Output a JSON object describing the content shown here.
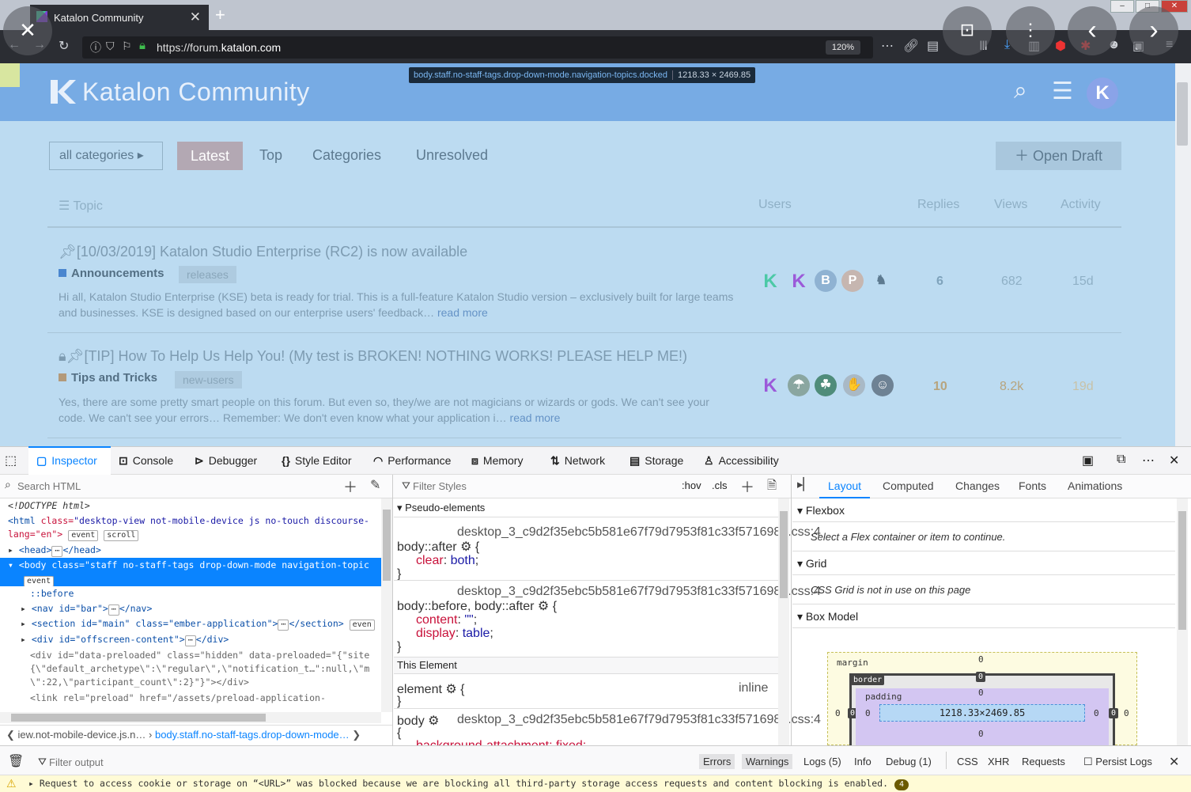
{
  "browser": {
    "tab_title": "Katalon Community",
    "new_tab": "+",
    "url_host_prefix": "https://forum.",
    "url_host": "katalon.com",
    "zoom": "120%"
  },
  "overlay": {
    "close": "✕",
    "prev": "‹",
    "next": "›"
  },
  "page": {
    "logo_text": "Katalon Community",
    "selector_tag": "body.staff.no-staff-tags.drop-down-mode.navigation-topics.docked",
    "selector_size": "1218.33 × 2469.85",
    "nav": {
      "all_categories": "all categories",
      "latest": "Latest",
      "top": "Top",
      "categories": "Categories",
      "unresolved": "Unresolved",
      "open_draft": "Open Draft"
    },
    "columns": {
      "topic": "Topic",
      "users": "Users",
      "replies": "Replies",
      "views": "Views",
      "activity": "Activity"
    },
    "topics": [
      {
        "title": "[10/03/2019] Katalon Studio Enterprise (RC2) is now available",
        "category": "Announcements",
        "category_color": "#4a86cf",
        "tag": "releases",
        "excerpt": "Hi all, Katalon Studio Enterprise (KSE) beta is ready for trial. This is a full-feature Katalon Studio version – exclusively built for large teams and businesses. KSE is designed based on our enterprise users' feedback…",
        "read_more": "read more",
        "replies": "6",
        "views": "682",
        "activity": "15d"
      },
      {
        "title": "[TIP] How To Help Us Help You! (My test is BROKEN! NOTHING WORKS! PLEASE HELP ME!)",
        "category": "Tips and Tricks",
        "category_color": "#b39a7a",
        "tag": "new-users",
        "excerpt": "Yes, there are some pretty smart people on this forum. But even so, they/we are not magicians or wizards or gods. We can't see your code. We can't see your errors… Remember: We don't even know what your application i…",
        "read_more": "read more",
        "replies": "10",
        "views": "8.2k",
        "activity": "19d"
      }
    ]
  },
  "devtools": {
    "tabs": [
      "Inspector",
      "Console",
      "Debugger",
      "Style Editor",
      "Performance",
      "Memory",
      "Network",
      "Storage",
      "Accessibility"
    ],
    "search_html_placeholder": "Search HTML",
    "filter_styles_placeholder": "Filter Styles",
    "hov": ":hov",
    "cls": ".cls",
    "layout_tabs": [
      "Layout",
      "Computed",
      "Changes",
      "Fonts",
      "Animations"
    ],
    "html_lines": {
      "doctype": "<!DOCTYPE html>",
      "html_open_tag": "<html",
      "html_class_attr": "class=",
      "html_class_val": "\"desktop-view not-mobile-device js no-touch discourse-",
      "html_lang": "lang=\"en\">",
      "event": "event",
      "scroll": "scroll",
      "head": "<head>",
      "head_close": "</head>",
      "body": "<body class=\"staff no-staff-tags drop-down-mode navigation-topic",
      "before": "::before",
      "nav": "<nav id=\"bar\">",
      "nav_close": "</nav>",
      "section": "<section id=\"main\" class=\"ember-application\">",
      "section_close": "</section>",
      "section_badge": "even",
      "offscreen": "<div id=\"offscreen-content\">",
      "div_close": "</div>",
      "preloaded1": "<div id=\"data-preloaded\" class=\"hidden\" data-preloaded=\"{\"site",
      "preloaded2": "{\\\"default_archetype\\\":\\\"regular\\\",\\\"notification_t…\":null,\\\"m",
      "preloaded3": "\\\":22,\\\"participant_count\\\":2}\"}\"></div>",
      "link": "<link rel=\"preload\" href=\"/assets/preload-application-",
      "ellipsis": "⋯"
    },
    "breadcrumbs": {
      "prev": "iew.not-mobile-device.js.n…",
      "current": "body.staff.no-staff-tags.drop-down-mode…"
    },
    "rules": {
      "pseudo_header": "Pseudo-elements",
      "source1": "desktop_3_c9d2f35ebc5b581e67f79d7953f81c33f5716986.css:4",
      "sel1": "body::after",
      "prop1": "clear",
      "val1": "both",
      "source2": "desktop_3_c9d2f35ebc5b581e67f79d7953f81c33f5716986.css:4",
      "sel2": "body::before, body::after",
      "prop2a": "content",
      "val2a": "\"\"",
      "prop2b": "display",
      "val2b": "table",
      "this_element": "This Element",
      "element_sel": "element",
      "inline": "inline",
      "sel3": "body",
      "source3": "desktop_3_c9d2f35ebc5b581e67f79d7953f81c33f5716986.css:4",
      "prop3": "background-attachment: fixed;"
    },
    "layout": {
      "flexbox": "Flexbox",
      "flex_msg": "Select a Flex container or item to continue.",
      "grid": "Grid",
      "grid_msg": "CSS Grid is not in use on this page",
      "box_model": "Box Model",
      "margin": "margin",
      "border": "border",
      "padding": "padding",
      "zero": "0",
      "content_size": "1218.33×2469.85"
    },
    "console": {
      "filter_placeholder": "Filter output",
      "errors": "Errors",
      "warnings": "Warnings",
      "logs": "Logs (5)",
      "info": "Info",
      "debug": "Debug (1)",
      "css": "CSS",
      "xhr": "XHR",
      "requests": "Requests",
      "persist": "Persist Logs",
      "warning_msg": "Request to access cookie or storage on “<URL>” was blocked because we are blocking all third-party storage access requests and content blocking is enabled.",
      "warning_count": "4"
    }
  }
}
